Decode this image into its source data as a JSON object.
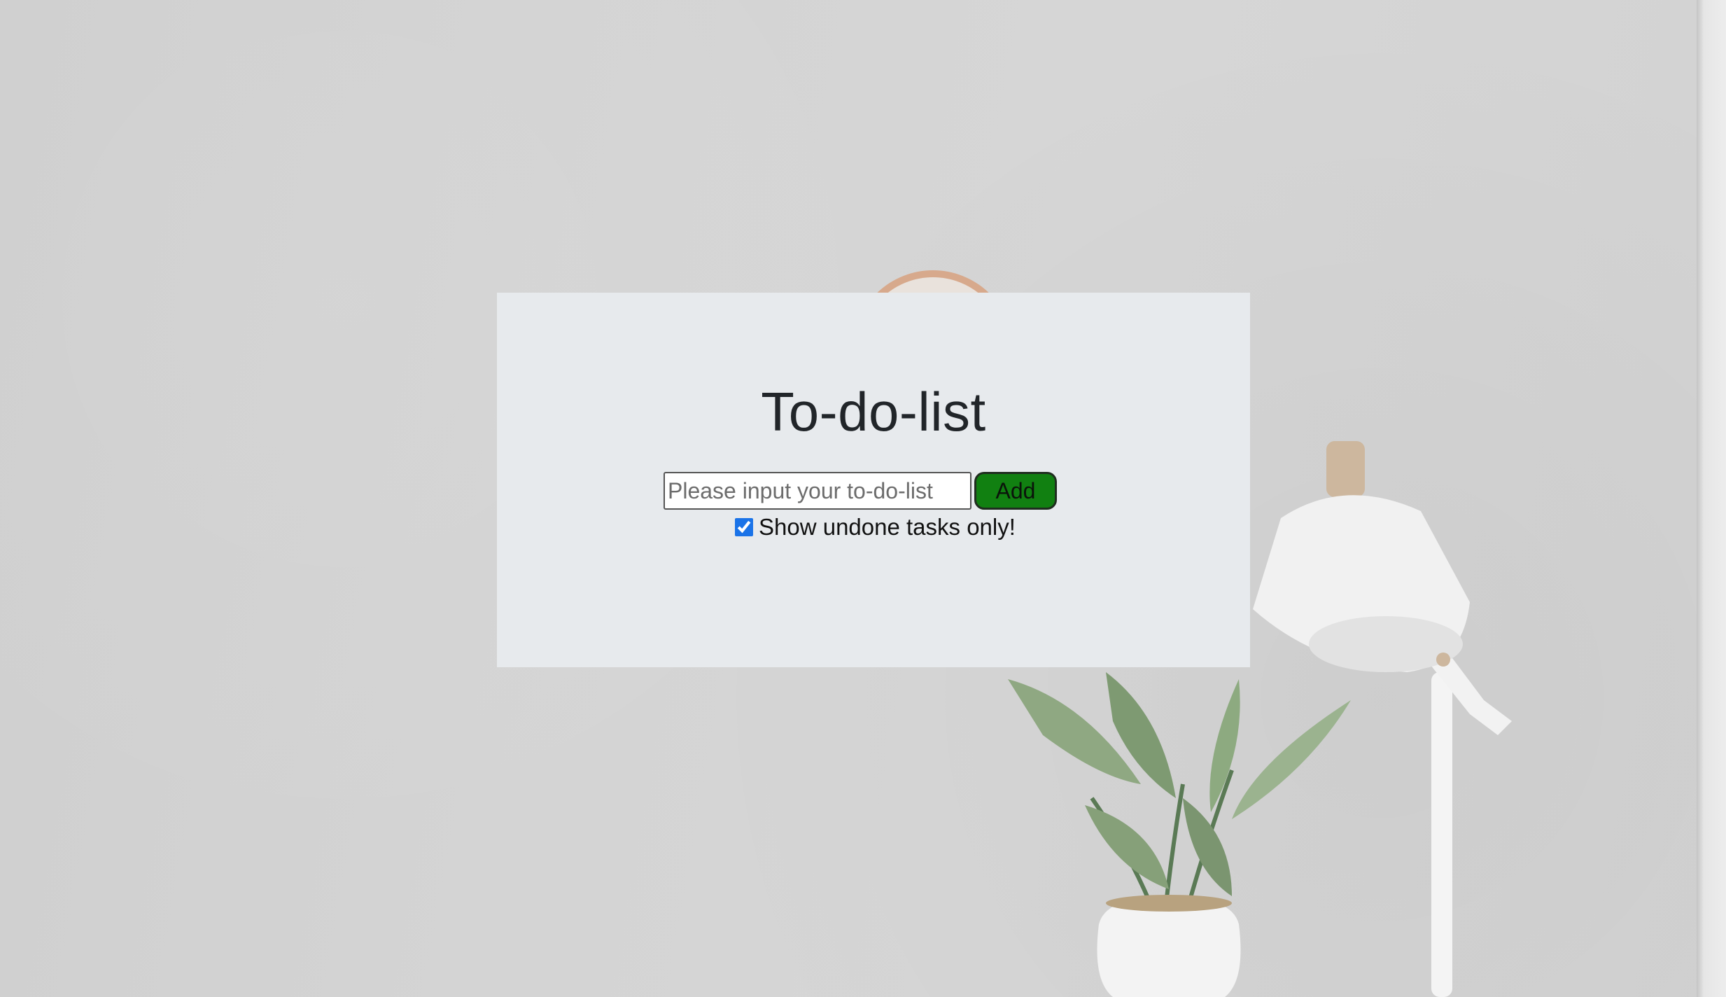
{
  "app": {
    "title": "To-do-list"
  },
  "form": {
    "input_placeholder": "Please input your to-do-list",
    "input_value": "",
    "add_label": "Add"
  },
  "filter": {
    "label": "Show undone tasks only!",
    "checked": true
  },
  "colors": {
    "card_background": "#e7eaed",
    "add_button": "#118011",
    "checkbox_accent": "#1a73e8"
  },
  "icons": {
    "decor": [
      "wall-clock-icon",
      "plant-icon",
      "desk-lamp-icon"
    ]
  }
}
